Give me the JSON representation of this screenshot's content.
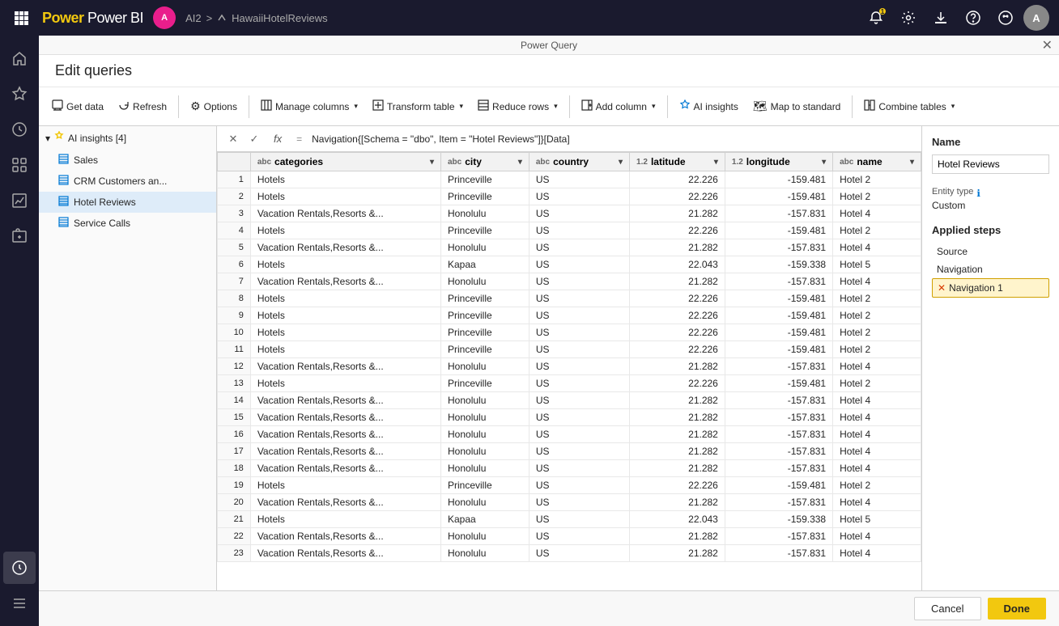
{
  "topbar": {
    "logo": "Power BI",
    "user_initial": "A",
    "user_name": "AI2",
    "breadcrumb_sep1": ">",
    "breadcrumb_item": "HawaiiHotelReviews",
    "notification_count": "1",
    "window_title": "Power Query"
  },
  "toolbar": {
    "get_data": "Get data",
    "refresh": "Refresh",
    "options": "Options",
    "manage_columns": "Manage columns",
    "transform_table": "Transform table",
    "reduce_rows": "Reduce rows",
    "add_column": "Add column",
    "ai_insights": "AI insights",
    "map_to_standard": "Map to standard",
    "combine_tables": "Combine tables"
  },
  "edit_queries_title": "Edit queries",
  "formula": {
    "expression": "= Navigation{[Schema = \"dbo\", Item = \"Hotel Reviews\"]}[Data]"
  },
  "queries": {
    "group_name": "AI insights [4]",
    "items": [
      {
        "name": "Sales",
        "icon": "table",
        "active": false
      },
      {
        "name": "CRM Customers an...",
        "icon": "table",
        "active": false
      },
      {
        "name": "Hotel Reviews",
        "icon": "table-highlighted",
        "active": true
      },
      {
        "name": "Service Calls",
        "icon": "table",
        "active": false
      }
    ]
  },
  "columns": [
    {
      "name": "categories",
      "type": "abc",
      "type_label": "abc"
    },
    {
      "name": "city",
      "type": "abc",
      "type_label": "abc"
    },
    {
      "name": "country",
      "type": "abc",
      "type_label": "abc"
    },
    {
      "name": "latitude",
      "type": "1.2",
      "type_label": "1.2"
    },
    {
      "name": "longitude",
      "type": "1.2",
      "type_label": "1.2"
    },
    {
      "name": "name",
      "type": "abc",
      "type_label": "abc"
    }
  ],
  "rows": [
    {
      "num": 1,
      "categories": "Hotels",
      "city": "Princeville",
      "country": "US",
      "latitude": "22.226",
      "longitude": "-159.481",
      "name": "Hotel 2"
    },
    {
      "num": 2,
      "categories": "Hotels",
      "city": "Princeville",
      "country": "US",
      "latitude": "22.226",
      "longitude": "-159.481",
      "name": "Hotel 2"
    },
    {
      "num": 3,
      "categories": "Vacation Rentals,Resorts &...",
      "city": "Honolulu",
      "country": "US",
      "latitude": "21.282",
      "longitude": "-157.831",
      "name": "Hotel 4"
    },
    {
      "num": 4,
      "categories": "Hotels",
      "city": "Princeville",
      "country": "US",
      "latitude": "22.226",
      "longitude": "-159.481",
      "name": "Hotel 2"
    },
    {
      "num": 5,
      "categories": "Vacation Rentals,Resorts &...",
      "city": "Honolulu",
      "country": "US",
      "latitude": "21.282",
      "longitude": "-157.831",
      "name": "Hotel 4"
    },
    {
      "num": 6,
      "categories": "Hotels",
      "city": "Kapaa",
      "country": "US",
      "latitude": "22.043",
      "longitude": "-159.338",
      "name": "Hotel 5"
    },
    {
      "num": 7,
      "categories": "Vacation Rentals,Resorts &...",
      "city": "Honolulu",
      "country": "US",
      "latitude": "21.282",
      "longitude": "-157.831",
      "name": "Hotel 4"
    },
    {
      "num": 8,
      "categories": "Hotels",
      "city": "Princeville",
      "country": "US",
      "latitude": "22.226",
      "longitude": "-159.481",
      "name": "Hotel 2"
    },
    {
      "num": 9,
      "categories": "Hotels",
      "city": "Princeville",
      "country": "US",
      "latitude": "22.226",
      "longitude": "-159.481",
      "name": "Hotel 2"
    },
    {
      "num": 10,
      "categories": "Hotels",
      "city": "Princeville",
      "country": "US",
      "latitude": "22.226",
      "longitude": "-159.481",
      "name": "Hotel 2"
    },
    {
      "num": 11,
      "categories": "Hotels",
      "city": "Princeville",
      "country": "US",
      "latitude": "22.226",
      "longitude": "-159.481",
      "name": "Hotel 2"
    },
    {
      "num": 12,
      "categories": "Vacation Rentals,Resorts &...",
      "city": "Honolulu",
      "country": "US",
      "latitude": "21.282",
      "longitude": "-157.831",
      "name": "Hotel 4"
    },
    {
      "num": 13,
      "categories": "Hotels",
      "city": "Princeville",
      "country": "US",
      "latitude": "22.226",
      "longitude": "-159.481",
      "name": "Hotel 2"
    },
    {
      "num": 14,
      "categories": "Vacation Rentals,Resorts &...",
      "city": "Honolulu",
      "country": "US",
      "latitude": "21.282",
      "longitude": "-157.831",
      "name": "Hotel 4"
    },
    {
      "num": 15,
      "categories": "Vacation Rentals,Resorts &...",
      "city": "Honolulu",
      "country": "US",
      "latitude": "21.282",
      "longitude": "-157.831",
      "name": "Hotel 4"
    },
    {
      "num": 16,
      "categories": "Vacation Rentals,Resorts &...",
      "city": "Honolulu",
      "country": "US",
      "latitude": "21.282",
      "longitude": "-157.831",
      "name": "Hotel 4"
    },
    {
      "num": 17,
      "categories": "Vacation Rentals,Resorts &...",
      "city": "Honolulu",
      "country": "US",
      "latitude": "21.282",
      "longitude": "-157.831",
      "name": "Hotel 4"
    },
    {
      "num": 18,
      "categories": "Vacation Rentals,Resorts &...",
      "city": "Honolulu",
      "country": "US",
      "latitude": "21.282",
      "longitude": "-157.831",
      "name": "Hotel 4"
    },
    {
      "num": 19,
      "categories": "Hotels",
      "city": "Princeville",
      "country": "US",
      "latitude": "22.226",
      "longitude": "-159.481",
      "name": "Hotel 2"
    },
    {
      "num": 20,
      "categories": "Vacation Rentals,Resorts &...",
      "city": "Honolulu",
      "country": "US",
      "latitude": "21.282",
      "longitude": "-157.831",
      "name": "Hotel 4"
    },
    {
      "num": 21,
      "categories": "Hotels",
      "city": "Kapaa",
      "country": "US",
      "latitude": "22.043",
      "longitude": "-159.338",
      "name": "Hotel 5"
    },
    {
      "num": 22,
      "categories": "Vacation Rentals,Resorts &...",
      "city": "Honolulu",
      "country": "US",
      "latitude": "21.282",
      "longitude": "-157.831",
      "name": "Hotel 4"
    },
    {
      "num": 23,
      "categories": "Vacation Rentals,Resorts &...",
      "city": "Honolulu",
      "country": "US",
      "latitude": "21.282",
      "longitude": "-157.831",
      "name": "Hotel 4"
    }
  ],
  "right_panel": {
    "name_label": "Name",
    "name_value": "Hotel Reviews",
    "entity_type_label": "Entity type",
    "entity_type_value": "Custom",
    "info_icon": "ℹ",
    "applied_steps_title": "Applied steps",
    "steps": [
      {
        "name": "Source",
        "active": false,
        "has_error": false
      },
      {
        "name": "Navigation",
        "active": false,
        "has_error": false
      },
      {
        "name": "Navigation 1",
        "active": true,
        "has_error": true
      }
    ]
  },
  "bottom_bar": {
    "cancel_label": "Cancel",
    "done_label": "Done"
  }
}
